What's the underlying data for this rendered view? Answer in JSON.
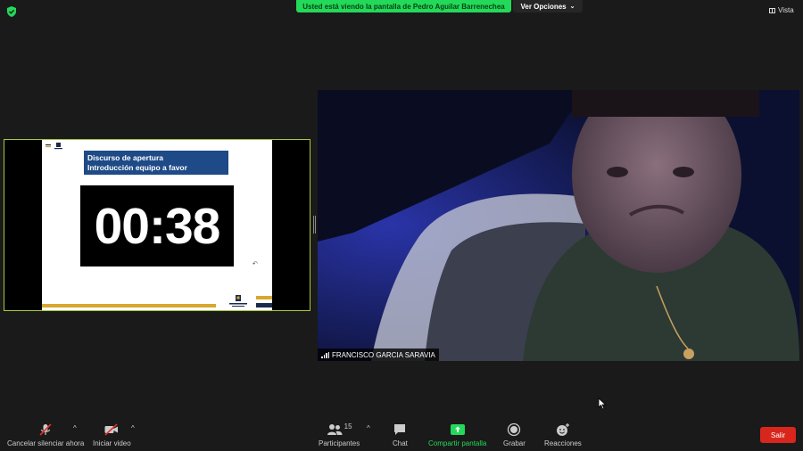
{
  "top_bar": {
    "share_banner": "Usted está viendo la pantalla de Pedro Aguilar Barrenechea",
    "view_options_label": "Ver Opciones",
    "view_label": "Vista"
  },
  "shared_screen": {
    "slide_title_line1": "Discurso de apertura",
    "slide_title_line2": "Introducción equipo a favor",
    "timer": "00:38"
  },
  "video": {
    "participant_name": "FRANCISCO GARCIA SARAVIA"
  },
  "toolbar": {
    "mute_label": "Cancelar silenciar ahora",
    "video_label": "Iniciar video",
    "participants_label": "Participantes",
    "participants_count": "15",
    "chat_label": "Chat",
    "share_label": "Compartir pantalla",
    "record_label": "Grabar",
    "reactions_label": "Reacciones",
    "leave_label": "Salir"
  },
  "colors": {
    "share_green": "#23d959",
    "leave_red": "#d8261d",
    "slide_title_blue": "#1e4a87",
    "slide_gold": "#d7a72e"
  }
}
